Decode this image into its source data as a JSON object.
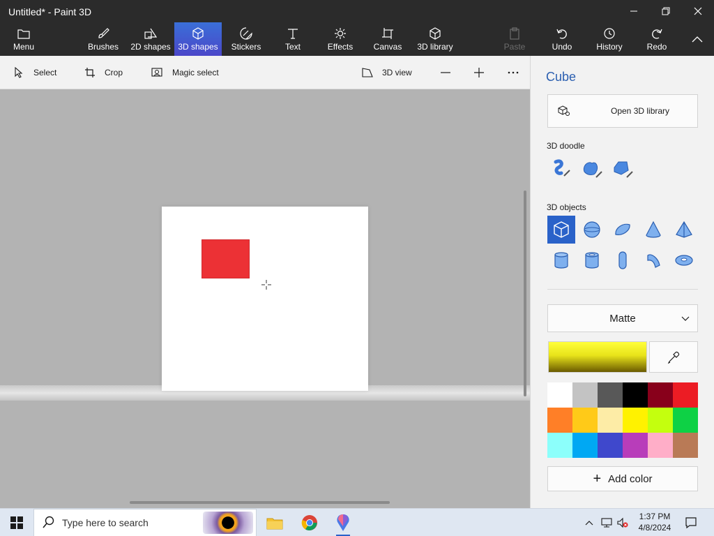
{
  "window": {
    "title": "Untitled* - Paint 3D",
    "minimize": "minimize-icon",
    "restore": "restore-icon",
    "close": "close-icon"
  },
  "ribbon": {
    "menu": "Menu",
    "items": [
      {
        "label": "Brushes",
        "icon": "brush-icon"
      },
      {
        "label": "2D shapes",
        "icon": "2d-shapes-icon"
      },
      {
        "label": "3D shapes",
        "icon": "3d-shapes-icon",
        "active": true
      },
      {
        "label": "Stickers",
        "icon": "stickers-icon"
      },
      {
        "label": "Text",
        "icon": "text-icon"
      },
      {
        "label": "Effects",
        "icon": "effects-icon"
      },
      {
        "label": "Canvas",
        "icon": "canvas-icon"
      },
      {
        "label": "3D library",
        "icon": "3d-library-icon"
      }
    ],
    "paste": "Paste",
    "undo": "Undo",
    "history": "History",
    "redo": "Redo"
  },
  "toolbar": {
    "select": "Select",
    "crop": "Crop",
    "magic_select": "Magic select",
    "view_3d": "3D view"
  },
  "panel": {
    "title": "Cube",
    "open_library": "Open 3D library",
    "doodle_label": "3D doodle",
    "objects_label": "3D objects",
    "material": "Matte",
    "current_color": "#f5ef20",
    "add_color": "Add color",
    "palette": [
      "#ffffff",
      "#c3c3c3",
      "#585858",
      "#000000",
      "#88001b",
      "#ec1c24",
      "#ff7f27",
      "#ffca18",
      "#fdeca6",
      "#fff200",
      "#c4ff0e",
      "#0ed145",
      "#8cfffb",
      "#00a8f3",
      "#3f48cc",
      "#b83dba",
      "#ffaec8",
      "#b97a56"
    ]
  },
  "taskbar": {
    "search_placeholder": "Type here to search",
    "time": "1:37 PM",
    "date": "4/8/2024"
  }
}
